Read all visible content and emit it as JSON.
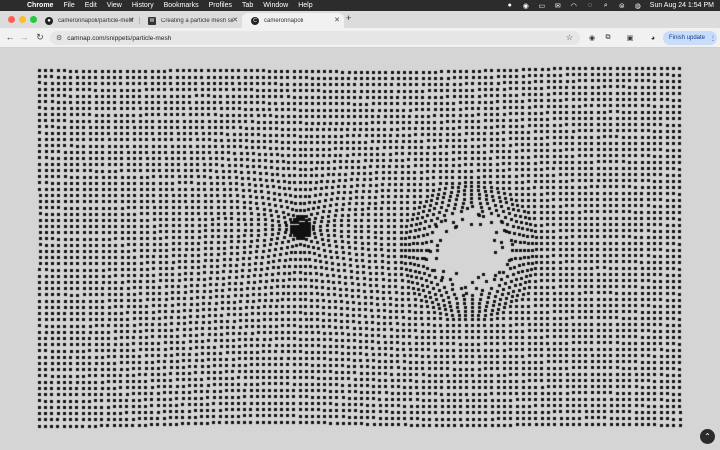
{
  "menubar": {
    "app": "Chrome",
    "items": [
      "File",
      "Edit",
      "View",
      "History",
      "Bookmarks",
      "Profiles",
      "Tab",
      "Window",
      "Help"
    ],
    "clock": "Sun Aug 24  1:54 PM"
  },
  "tabs": [
    {
      "title": "cameronnapoli/particle-mesh",
      "icon": "github-icon"
    },
    {
      "title": "Creating a particle mesh simu",
      "icon": "article-icon"
    },
    {
      "title": "cameronnapoli",
      "icon": "site-icon",
      "active": true
    }
  ],
  "toolbar": {
    "url": "camnap.com/snippets/particle-mesh",
    "update_label": "Finish update"
  },
  "mesh": {
    "particle_color": "#111111",
    "background": "#d5d5d5",
    "attractor_strength": 1,
    "repulsor_strength": 1
  },
  "colors": {
    "close": "#ff5f57",
    "minimize": "#febc2e",
    "zoom": "#28c840",
    "accent": "#c9dcf9"
  }
}
